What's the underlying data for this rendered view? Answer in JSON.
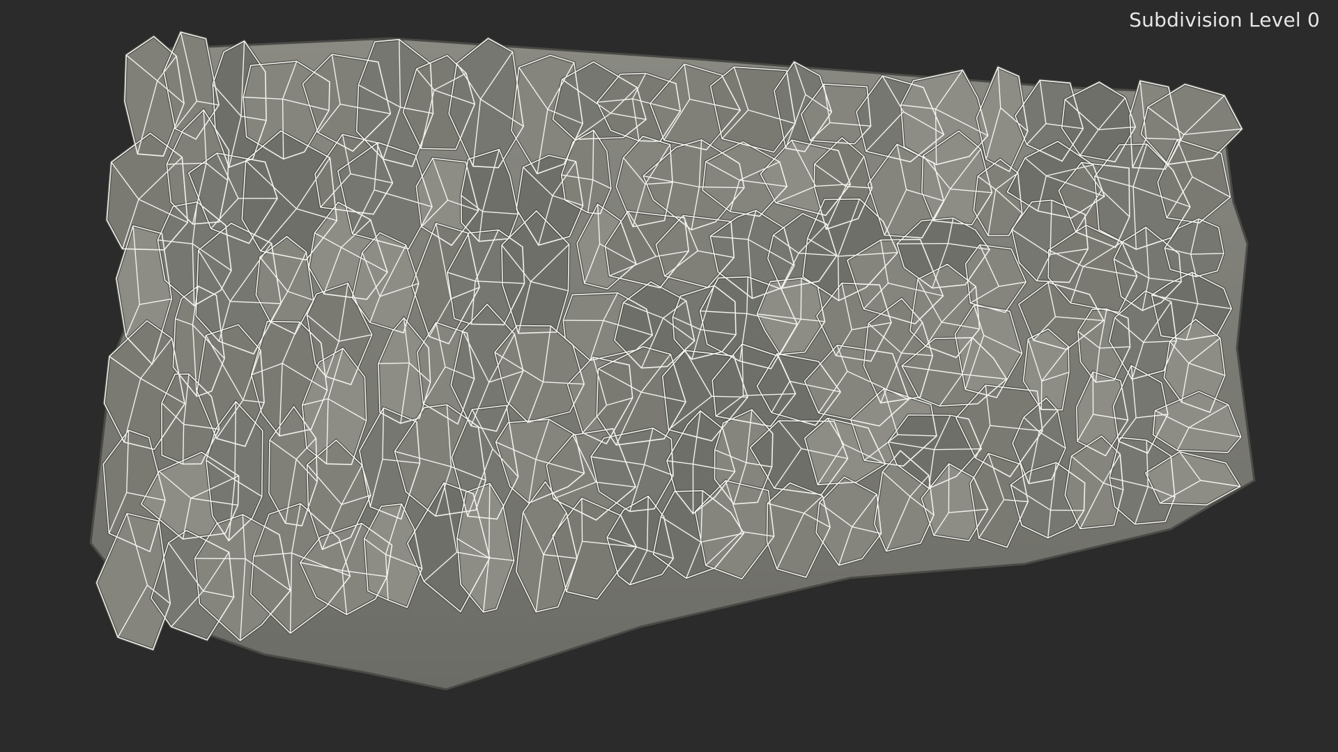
{
  "viewport": {
    "label": "Subdivision Level 0",
    "background": "#2b2b2b"
  },
  "model": {
    "surface_color": "#7f7f78",
    "surface_shadow": "#5e5e58",
    "surface_highlight": "#9a9a92",
    "wireframe_color": "#f2f2ee"
  }
}
